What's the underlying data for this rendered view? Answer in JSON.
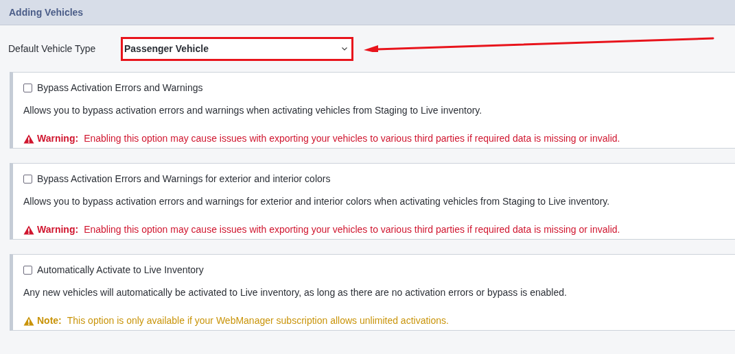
{
  "header": {
    "title": "Adding Vehicles"
  },
  "default_vehicle_type": {
    "label": "Default Vehicle Type",
    "value": "Passenger Vehicle"
  },
  "options": [
    {
      "label": "Bypass Activation Errors and Warnings",
      "checked": false,
      "description": "Allows you to bypass activation errors and warnings when activating vehicles from Staging to Live inventory.",
      "notice": {
        "kind": "warning",
        "prefix": "Warning:",
        "text": "Enabling this option may cause issues with exporting your vehicles to various third parties if required data is missing or invalid."
      }
    },
    {
      "label": "Bypass Activation Errors and Warnings for exterior and interior colors",
      "checked": false,
      "description": "Allows you to bypass activation errors and warnings for exterior and interior colors when activating vehicles from Staging to Live inventory.",
      "notice": {
        "kind": "warning",
        "prefix": "Warning:",
        "text": "Enabling this option may cause issues with exporting your vehicles to various third parties if required data is missing or invalid."
      }
    },
    {
      "label": "Automatically Activate to Live Inventory",
      "checked": false,
      "description": "Any new vehicles will automatically be activated to Live inventory, as long as there are no activation errors or bypass is enabled.",
      "notice": {
        "kind": "note",
        "prefix": "Note:",
        "text": "This option is only available if your WebManager subscription allows unlimited activations."
      }
    }
  ]
}
